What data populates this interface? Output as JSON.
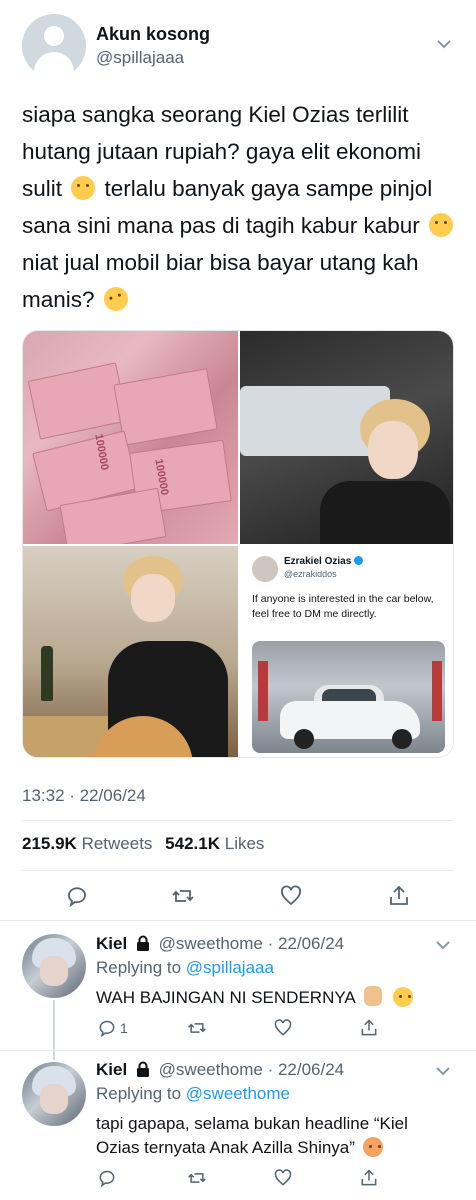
{
  "tweet": {
    "display_name": "Akun kosong",
    "handle": "@spillajaaa",
    "text_parts": [
      "siapa sangka seorang Kiel Ozias terlilit hutang jutaan rupiah? gaya elit ekonomi sulit",
      "terlalu banyak gaya sampe pinjol sana sini mana pas di tagih kabur kabur",
      "niat jual mobil biar bisa bayar utang kah manis?"
    ],
    "emojis": [
      "shushing-face-emoji",
      "steam-face-emoji",
      "rofl-emoji"
    ],
    "timestamp": "13:32 · 22/06/24",
    "retweets_count": "215.9K",
    "retweets_label": "Retweets",
    "likes_count": "542.1K",
    "likes_label": "Likes"
  },
  "media": {
    "money_label": "100000",
    "embedded_tweet": {
      "name": "Ezrakiel Ozias",
      "handle": "@ezrakiddos",
      "text": "If anyone is interested in the car below, feel free to DM me directly."
    }
  },
  "actions": [
    "reply-icon",
    "retweet-icon",
    "like-icon",
    "share-icon"
  ],
  "replies": [
    {
      "name": "Kiel",
      "handle_time": "@sweethome · 22/06/24",
      "replying_prefix": "Replying to",
      "replying_to": "@spillajaaa",
      "text": "WAH BAJINGAN NI SENDERNYA",
      "reply_count": "1"
    },
    {
      "name": "Kiel",
      "handle_time": "@sweethome · 22/06/24",
      "replying_prefix": "Replying to",
      "replying_to": "@sweethome",
      "text": "tapi gapapa, selama bukan headline “Kiel Ozias ternyata Anak Azilla Shinya”",
      "reply_count": ""
    }
  ],
  "colors": {
    "accent": "#1d9bf0",
    "text": "#0f1419",
    "secondary": "#536471"
  }
}
